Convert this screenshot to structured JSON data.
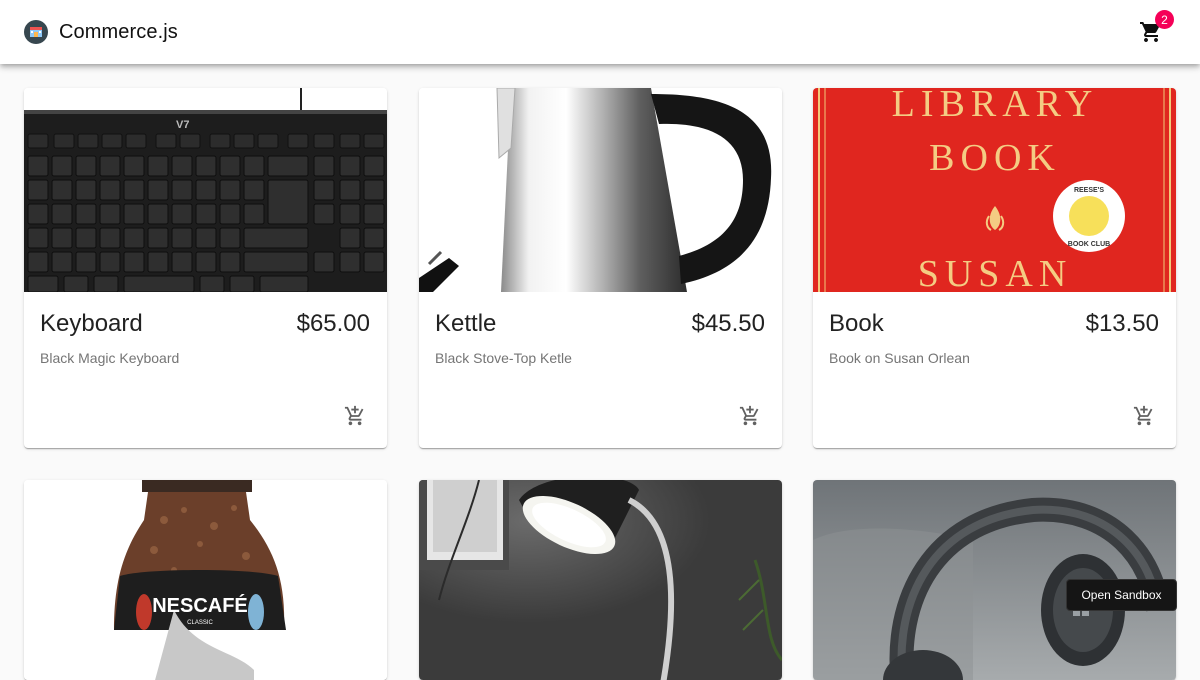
{
  "header": {
    "title": "Commerce.js",
    "logo_icon": "store-icon",
    "cart_icon": "shopping-cart-icon",
    "cart_count": "2",
    "badge_color": "#f50057"
  },
  "products": [
    {
      "name": "Keyboard",
      "price": "$65.00",
      "description": "Black Magic Keyboard",
      "add_icon": "add-shopping-cart-icon"
    },
    {
      "name": "Kettle",
      "price": "$45.50",
      "description": "Black Stove-Top Ketle",
      "add_icon": "add-shopping-cart-icon"
    },
    {
      "name": "Book",
      "price": "$13.50",
      "description": "Book on Susan Orlean",
      "add_icon": "add-shopping-cart-icon"
    },
    {
      "image": "coffee-jar"
    },
    {
      "image": "desk-lamp"
    },
    {
      "image": "headphones"
    }
  ],
  "book_cover": {
    "line1": "LIBRARY",
    "line2": "BOOK",
    "line3": "SUSAN",
    "sticker_top": "REESE'S",
    "sticker_bottom": "BOOK CLUB"
  },
  "coffee_label": {
    "brand": "NESCAFÉ",
    "variant": "CLASSIC"
  },
  "sandbox_button": "Open Sandbox"
}
